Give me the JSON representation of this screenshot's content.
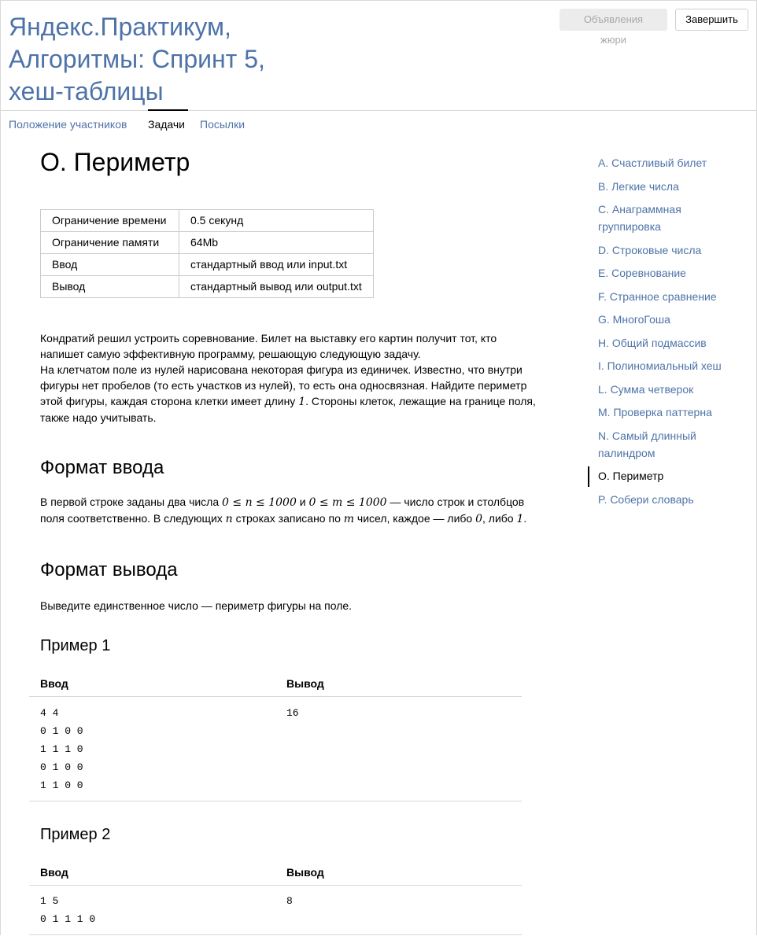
{
  "header": {
    "title": "Яндекс.Практикум, Алгоритмы: Спринт 5, хеш-таблицы",
    "jury_button": "Объявления жюри",
    "finish_button": "Завершить"
  },
  "tabs": [
    {
      "label": "Положение участников",
      "active": false
    },
    {
      "label": "Задачи",
      "active": true
    },
    {
      "label": "Посылки",
      "active": false
    }
  ],
  "problem": {
    "title": "O. Периметр",
    "limits": [
      {
        "key": "Ограничение времени",
        "value": "0.5 секунд"
      },
      {
        "key": "Ограничение памяти",
        "value": "64Mb"
      },
      {
        "key": "Ввод",
        "value": "стандартный ввод или input.txt"
      },
      {
        "key": "Вывод",
        "value": "стандартный вывод или output.txt"
      }
    ],
    "legend": {
      "p1": "Кондратий решил устроить соревнование. Билет на выставку его картин получит тот, кто напишет самую эффективную программу, решающую следующую задачу.",
      "p2_a": "На клетчатом поле из нулей нарисована некоторая фигура из единичек. Известно, что внутри фигуры нет пробелов (то есть участков из нулей), то есть она односвязная. Найдите периметр этой фигуры, каждая сторона клетки имеет длину ",
      "p2_m": "1",
      "p2_b": ". Стороны клеток, лежащие на границе поля, также надо учитывать."
    },
    "input_format": {
      "heading": "Формат ввода",
      "t1": "В первой строке заданы два числа ",
      "m1": "0 ≤ n ≤ 1000",
      "t2": " и ",
      "m2": "0 ≤ m ≤ 1000",
      "t3": " — число строк и столбцов поля соответственно. В следующих ",
      "m3": "n",
      "t4": " строках записано по ",
      "m4": "m",
      "t5": " чисел, каждое — либо ",
      "m5": "0",
      "t6": ", либо ",
      "m6": "1",
      "t7": "."
    },
    "output_format": {
      "heading": "Формат вывода",
      "text": "Выведите единственное число — периметр фигуры на поле."
    },
    "examples": [
      {
        "heading": "Пример 1",
        "input_label": "Ввод",
        "output_label": "Вывод",
        "input": "4 4\n0 1 0 0\n1 1 1 0\n0 1 0 0\n1 1 0 0",
        "output": "16"
      },
      {
        "heading": "Пример 2",
        "input_label": "Ввод",
        "output_label": "Вывод",
        "input": "1 5\n0 1 1 1 0",
        "output": "8"
      }
    ]
  },
  "sidebar": {
    "items": [
      {
        "label": "A. Счастливый билет",
        "active": false
      },
      {
        "label": "B. Легкие числа",
        "active": false
      },
      {
        "label": "C. Анаграммная группировка",
        "active": false
      },
      {
        "label": "D. Строковые числа",
        "active": false
      },
      {
        "label": "E. Соревнование",
        "active": false
      },
      {
        "label": "F. Странное сравнение",
        "active": false
      },
      {
        "label": "G. МногоГоша",
        "active": false
      },
      {
        "label": "H. Общий подмассив",
        "active": false
      },
      {
        "label": "I. Полиномиальный хеш",
        "active": false
      },
      {
        "label": "L. Сумма четверок",
        "active": false
      },
      {
        "label": "M. Проверка паттерна",
        "active": false
      },
      {
        "label": "N. Самый длинный палиндром",
        "active": false
      },
      {
        "label": "O. Периметр",
        "active": true
      },
      {
        "label": "P. Собери словарь",
        "active": false
      }
    ]
  },
  "colors": {
    "link": "#4e73a8",
    "border": "#d9d9d9",
    "disabled_button_bg": "#ececec"
  }
}
